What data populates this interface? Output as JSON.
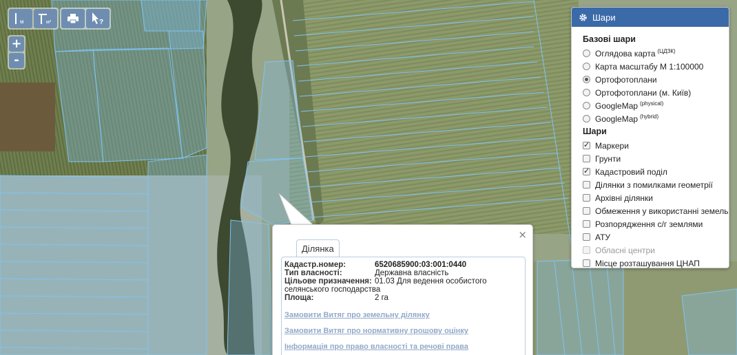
{
  "toolbar": {
    "measure_length_icon": "ruler-length-icon",
    "measure_length_label": "м",
    "measure_area_icon": "ruler-area-icon",
    "measure_area_label": "м²",
    "print_icon": "printer-icon",
    "identify_icon": "pointer-question-icon"
  },
  "zoom": {
    "in_label": "+",
    "out_label": "-"
  },
  "layers_panel": {
    "title": "Шари",
    "base_layers_title": "Базові шари",
    "base_layers": [
      {
        "label": "Оглядова карта",
        "sup": "(ЦДЗК)",
        "selected": false
      },
      {
        "label": "Карта масштабу М 1:100000",
        "sup": "",
        "selected": false
      },
      {
        "label": "Ортофотоплани",
        "sup": "",
        "selected": true
      },
      {
        "label": "Ортофотоплани (м. Київ)",
        "sup": "",
        "selected": false
      },
      {
        "label": "GoogleMap",
        "sup": "(physical)",
        "selected": false
      },
      {
        "label": "GoogleMap",
        "sup": "(hybrid)",
        "selected": false
      }
    ],
    "overlays_title": "Шари",
    "overlays": [
      {
        "label": "Маркери",
        "checked": true,
        "disabled": false
      },
      {
        "label": "Грунти",
        "checked": false,
        "disabled": false
      },
      {
        "label": "Кадастровий поділ",
        "checked": true,
        "disabled": false
      },
      {
        "label": "Ділянки з помилками геометрії",
        "checked": false,
        "disabled": false
      },
      {
        "label": "Архівні ділянки",
        "checked": false,
        "disabled": false
      },
      {
        "label": "Обмеження у використанні земель",
        "checked": false,
        "disabled": false
      },
      {
        "label": "Розпорядження с/г землями",
        "checked": false,
        "disabled": false
      },
      {
        "label": "АТУ",
        "checked": false,
        "disabled": false
      },
      {
        "label": "Обласні центри",
        "checked": false,
        "disabled": true
      },
      {
        "label": "Місце розташування ЦНАП",
        "checked": false,
        "disabled": false
      }
    ]
  },
  "popup": {
    "close_label": "×",
    "tab_label": "Ділянка",
    "fields": {
      "cadastral_number_label": "Кадастр.номер:",
      "cadastral_number": "6520685900:03:001:0440",
      "ownership_type_label": "Тип власності:",
      "ownership_type": "Державна власність",
      "purpose_label": "Цільове призначення:",
      "purpose": "01.03 Для ведення особистого селянського господарства",
      "area_label": "Площа:",
      "area": "2 га"
    },
    "links": [
      "Замовити Витяг про земельну ділянку",
      "Замовити Витяг про нормативну грошову оцінку",
      "Інформація про право власності та речові права"
    ]
  },
  "colors": {
    "accent": "#3b6aa8",
    "toolbar_button": "#6f8db1",
    "parcel_outline": "#7fc4f2",
    "link": "#92a9c8"
  }
}
